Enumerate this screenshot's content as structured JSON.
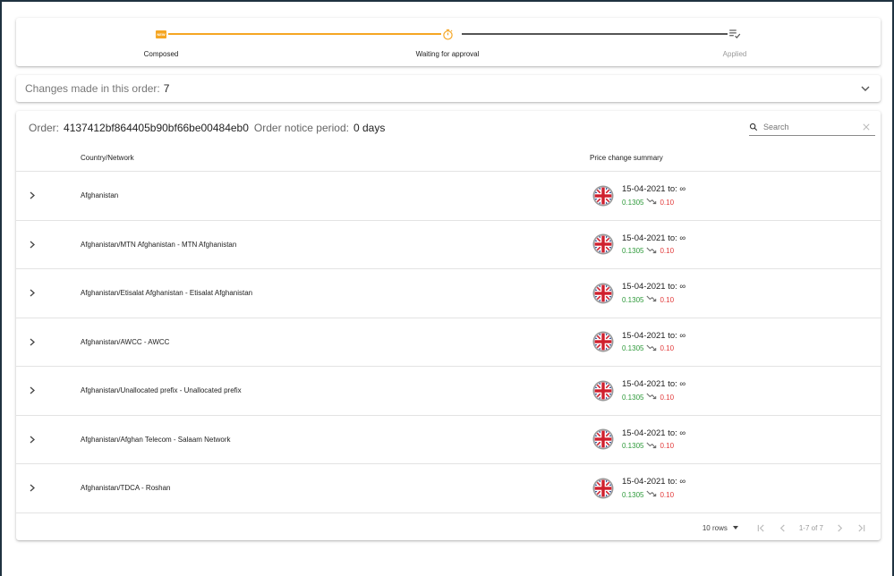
{
  "stepper": {
    "steps": [
      {
        "label": "Composed",
        "icon": "new-badge-icon",
        "state": "done"
      },
      {
        "label": "Waiting for approval",
        "icon": "stopwatch-icon",
        "state": "current"
      },
      {
        "label": "Applied",
        "icon": "playlist-check-icon",
        "state": "pending"
      }
    ],
    "new_badge_text": "NEW"
  },
  "changes": {
    "label": "Changes made in this order:",
    "count": "7"
  },
  "order": {
    "order_label": "Order:",
    "order_id": "4137412bf864405b90bf66be00484eb0",
    "notice_label": "Order notice period:",
    "notice_value": "0 days",
    "search_placeholder": "Search"
  },
  "table": {
    "headers": {
      "country": "Country/Network",
      "summary": "Price change summary"
    },
    "rows": [
      {
        "country": "Afghanistan",
        "date": "15-04-2021 to: ∞",
        "old": "0.1305",
        "new": "0.10"
      },
      {
        "country": "Afghanistan/MTN Afghanistan - MTN Afghanistan",
        "date": "15-04-2021 to: ∞",
        "old": "0.1305",
        "new": "0.10"
      },
      {
        "country": "Afghanistan/Etisalat Afghanistan - Etisalat Afghanistan",
        "date": "15-04-2021 to: ∞",
        "old": "0.1305",
        "new": "0.10"
      },
      {
        "country": "Afghanistan/AWCC - AWCC",
        "date": "15-04-2021 to: ∞",
        "old": "0.1305",
        "new": "0.10"
      },
      {
        "country": "Afghanistan/Unallocated prefix - Unallocated prefix",
        "date": "15-04-2021 to: ∞",
        "old": "0.1305",
        "new": "0.10"
      },
      {
        "country": "Afghanistan/Afghan Telecom - Salaam Network",
        "date": "15-04-2021 to: ∞",
        "old": "0.1305",
        "new": "0.10"
      },
      {
        "country": "Afghanistan/TDCA - Roshan",
        "date": "15-04-2021 to: ∞",
        "old": "0.1305",
        "new": "0.10"
      }
    ]
  },
  "pager": {
    "rows_label": "10 rows",
    "range": "1-7 of 7"
  },
  "colors": {
    "accent": "#f5a623",
    "increase": "#2e9a3a",
    "decrease": "#e23b3b"
  }
}
